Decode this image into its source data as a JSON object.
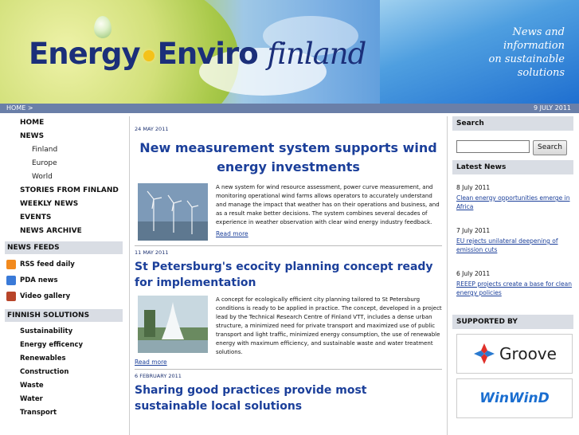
{
  "header": {
    "logo_energy": "Energy",
    "logo_enviro": "Enviro",
    "logo_finland": "finland",
    "tagline": [
      "News and",
      "information",
      "on sustainable",
      "solutions"
    ]
  },
  "navbar": {
    "breadcrumb": "HOME >",
    "date": "9 JULY 2011"
  },
  "left": {
    "nav": [
      {
        "label": "HOME",
        "type": "top"
      },
      {
        "label": "NEWS",
        "type": "top"
      },
      {
        "label": "Finland",
        "type": "sub"
      },
      {
        "label": "Europe",
        "type": "sub"
      },
      {
        "label": "World",
        "type": "sub"
      },
      {
        "label": "STORIES FROM FINLAND",
        "type": "top"
      },
      {
        "label": "WEEKLY NEWS",
        "type": "top"
      },
      {
        "label": "EVENTS",
        "type": "top"
      },
      {
        "label": "NEWS ARCHIVE",
        "type": "top"
      }
    ],
    "feeds_title": "NEWS FEEDS",
    "feeds": [
      "RSS feed daily",
      "PDA news",
      "Video gallery"
    ],
    "solutions_title": "FINNISH SOLUTIONS",
    "solutions": [
      "Sustainability",
      "Energy efficency",
      "Renewables",
      "Construction",
      "Waste",
      "Water",
      "Transport"
    ]
  },
  "articles": [
    {
      "date": "24 MAY 2011",
      "title": "New measurement system supports wind energy investments",
      "body": "A new system for wind resource assessment, power curve measurement, and monitoring operational wind farms allows operators to accurately understand and manage the impact that weather has on their operations and business, and as a result make better decisions. The system combines several decades of experience in weather observation with clear wind energy industry feedback.",
      "read_more": "Read more"
    },
    {
      "date": "11 MAY 2011",
      "title": "St Petersburg's ecocity planning concept ready for implementation",
      "body": "A concept for ecologically efficient city planning tailored to St Petersburg conditions is ready to be applied in practice. The concept, developed in a project lead by the Technical Research Centre of Finland VTT, includes a dense urban structure, a minimized need for private transport and maximized use of public transport and light traffic, minimized energy consumption, the use of renewable energy with maximum efficiency, and sustainable waste and water treatment solutions.",
      "read_more": "Read more"
    },
    {
      "date": "6 FEBRUARY 2011",
      "title": "Sharing good practices provide most sustainable local solutions"
    }
  ],
  "right": {
    "search_title": "Search",
    "search_button": "Search",
    "latest_title": "Latest News",
    "latest": [
      {
        "date": "8 July 2011",
        "title": "Clean energy opportunities emerge in Africa"
      },
      {
        "date": "7 July 2011",
        "title": "EU rejects unilateral deepening of emission cuts"
      },
      {
        "date": "6 July 2011",
        "title": "REEEP projects create a base for clean energy policies"
      }
    ],
    "supported_title": "SUPPORTED BY",
    "sponsors": [
      "Groove",
      "WinWinD"
    ]
  },
  "colors": {
    "link": "#1b3f9a",
    "navbar": "#6a7fa8",
    "box_title": "#d9dde4",
    "logo": "#1b2f7a"
  }
}
